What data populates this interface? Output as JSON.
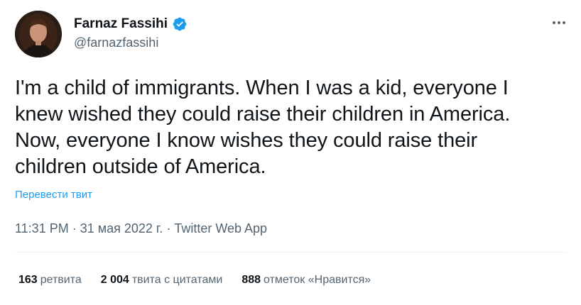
{
  "author": {
    "name": "Farnaz Fassihi",
    "handle": "@farnazfassihi",
    "verified": true
  },
  "icons": {
    "avatar": "profile-photo",
    "verified": "verified-badge-icon",
    "more": "more-options-icon"
  },
  "tweet": {
    "text_lines": [
      "I'm a child of immigrants. When I was a kid, everyone I",
      "knew wished they could raise their children in America.",
      "Now, everyone I know wishes they could raise their",
      "children outside of America."
    ],
    "translate_label": "Перевести твит"
  },
  "meta": {
    "time": "11:31 PM",
    "date": "31 мая 2022 г.",
    "source": "Twitter Web App",
    "separator": "·"
  },
  "stats": {
    "retweets": {
      "count": "163",
      "label": "ретвита"
    },
    "quotes": {
      "count": "2 004",
      "label": "твита с цитатами"
    },
    "likes": {
      "count": "888",
      "label": "отметок «Нравится»"
    }
  },
  "colors": {
    "accent": "#1d9bf0",
    "text": "#0f1419",
    "secondary": "#536471",
    "divider": "#eff3f4"
  }
}
